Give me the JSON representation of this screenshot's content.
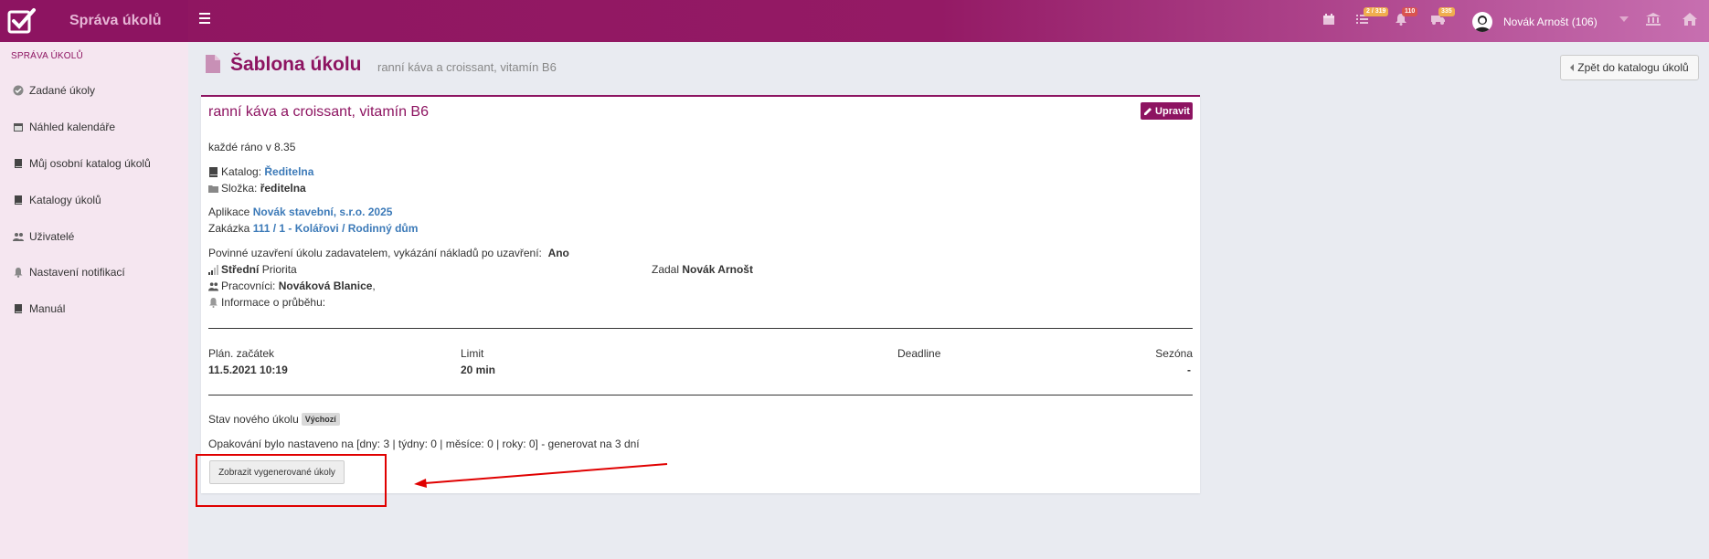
{
  "app": {
    "brand": "Správa úkolů"
  },
  "topbar": {
    "badges": {
      "tasks": "2 / 319",
      "notifications": "110",
      "truck": "335"
    },
    "user_name": "Novák Arnošt (106)"
  },
  "sidebar": {
    "section_title": "SPRÁVA ÚKOLŮ",
    "items": [
      {
        "label": "Zadané úkoly",
        "icon": "check-circle-icon"
      },
      {
        "label": "Náhled kalendáře",
        "icon": "calendar-icon"
      },
      {
        "label": "Můj osobní katalog úkolů",
        "icon": "book-icon"
      },
      {
        "label": "Katalogy úkolů",
        "icon": "book-icon"
      },
      {
        "label": "Uživatelé",
        "icon": "users-icon"
      },
      {
        "label": "Nastavení notifikací",
        "icon": "bell-icon"
      },
      {
        "label": "Manuál",
        "icon": "book-icon"
      }
    ]
  },
  "header": {
    "title": "Šablona úkolu",
    "subtitle": "ranní káva a croissant, vitamín B6",
    "back_button": "Zpět do katalogu úkolů"
  },
  "card": {
    "title": "ranní káva a croissant, vitamín B6",
    "edit_button": "Upravit",
    "description": "každé ráno v 8.35",
    "catalog_label": "Katalog:",
    "catalog_value": "Ředitelna",
    "folder_label": "Složka:",
    "folder_value": "ředitelna",
    "app_label": "Aplikace",
    "app_value": "Novák stavební, s.r.o. 2025",
    "order_label": "Zakázka",
    "order_value": "111 / 1 - Kolářovi / Rodinný dům",
    "closing_label": "Povinné uzavření úkolu zadavatelem, vykázání nákladů po uzavření:",
    "closing_value": "Ano",
    "priority_value": "Střední",
    "priority_label": "Priorita",
    "assigned_by_label": "Zadal",
    "assigned_by_value": "Novák Arnošt",
    "workers_label": "Pracovníci:",
    "workers_value": "Nováková Blanice",
    "workers_suffix": ",",
    "progress_label": "Informace o průběhu:",
    "plan_start_label": "Plán. začátek",
    "plan_start_value": "11.5.2021 10:19",
    "limit_label": "Limit",
    "limit_value": "20 min",
    "deadline_label": "Deadline",
    "season_label": "Sezóna",
    "season_value": "-",
    "new_state_label": "Stav nového úkolu",
    "new_state_badge": "Výchozí",
    "repeat_text": "Opakování bylo nastaveno na [dny: 3 | týdny: 0 | měsíce: 0 | roky: 0] - generovat na 3 dní",
    "generate_button": "Zobrazit vygenerované úkoly"
  }
}
